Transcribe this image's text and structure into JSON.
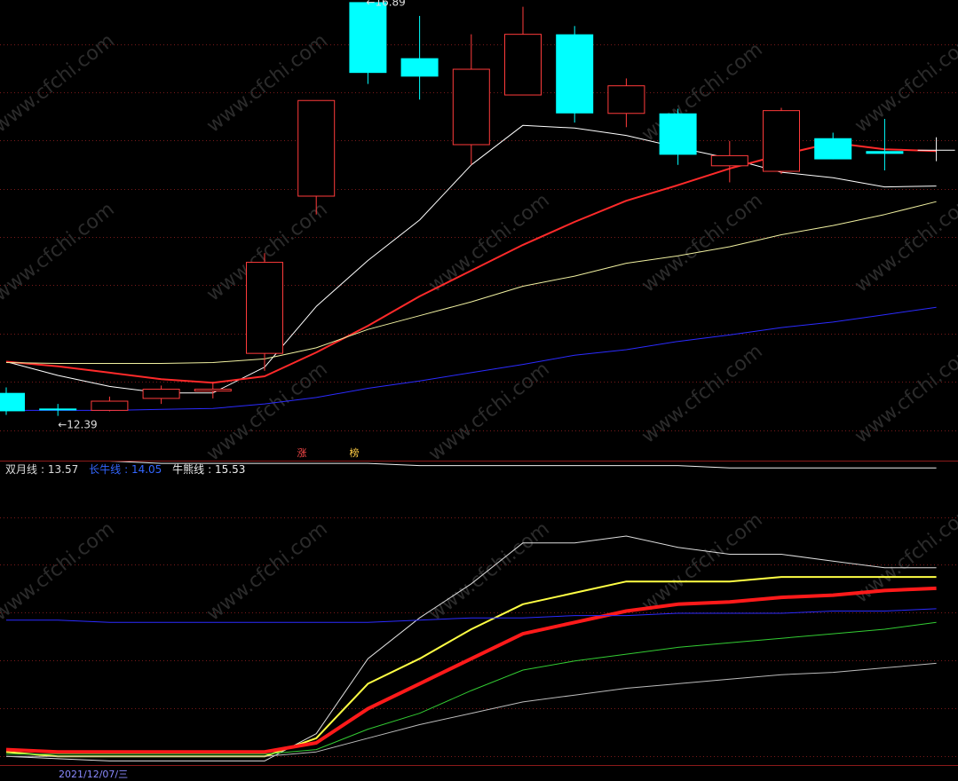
{
  "colors": {
    "background": "#000000",
    "grid": "#7a1a1a",
    "up_candle": "#ff3b3b",
    "down_candle": "#00ffff",
    "divider": "#8b1a1a",
    "watermark": "#2b2b2b"
  },
  "watermark_text": "www.cfchi.com",
  "price_panel": {
    "high_label": "16.89",
    "low_label": "12.39",
    "badges": [
      {
        "text": "涨",
        "color": "#ff4a4a"
      },
      {
        "text": "榜",
        "color": "#ffcc44"
      }
    ]
  },
  "legend": {
    "items": [
      {
        "name": "双月线",
        "value": "13.57",
        "color": "#dddddd"
      },
      {
        "name": "长牛线",
        "value": "14.05",
        "color": "#3366ff"
      },
      {
        "name": "牛熊线",
        "value": "15.53",
        "color": "#eeeeee"
      }
    ]
  },
  "date_label": "2021/12/07/三",
  "chart_data": [
    {
      "type": "candlestick",
      "title": "",
      "ylim": [
        12.0,
        17.0
      ],
      "candles": [
        {
          "open": 12.64,
          "close": 12.44,
          "high": 12.7,
          "low": 12.4,
          "dir": "down"
        },
        {
          "open": 12.47,
          "close": 12.45,
          "high": 12.52,
          "low": 12.39,
          "dir": "down"
        },
        {
          "open": 12.45,
          "close": 12.55,
          "high": 12.6,
          "low": 12.44,
          "dir": "up"
        },
        {
          "open": 12.58,
          "close": 12.68,
          "high": 12.72,
          "low": 12.52,
          "dir": "up"
        },
        {
          "open": 12.66,
          "close": 12.68,
          "high": 12.76,
          "low": 12.58,
          "dir": "up"
        },
        {
          "open": 13.07,
          "close": 14.06,
          "high": 14.16,
          "low": 12.88,
          "dir": "up"
        },
        {
          "open": 14.78,
          "close": 15.82,
          "high": 15.82,
          "low": 14.58,
          "dir": "up"
        },
        {
          "open": 16.12,
          "close": 16.89,
          "high": 16.89,
          "low": 16.0,
          "dir": "down"
        },
        {
          "open": 16.08,
          "close": 16.28,
          "high": 16.74,
          "low": 15.83,
          "dir": "down"
        },
        {
          "open": 15.34,
          "close": 16.16,
          "high": 16.54,
          "low": 15.12,
          "dir": "up"
        },
        {
          "open": 15.88,
          "close": 16.54,
          "high": 16.84,
          "low": 15.88,
          "dir": "up"
        },
        {
          "open": 15.68,
          "close": 16.54,
          "high": 16.63,
          "low": 15.58,
          "dir": "down"
        },
        {
          "open": 15.68,
          "close": 15.98,
          "high": 16.06,
          "low": 15.53,
          "dir": "up"
        },
        {
          "open": 15.23,
          "close": 15.68,
          "high": 15.73,
          "low": 15.12,
          "dir": "down"
        },
        {
          "open": 15.11,
          "close": 15.22,
          "high": 15.38,
          "low": 14.93,
          "dir": "up"
        },
        {
          "open": 15.05,
          "close": 15.71,
          "high": 15.74,
          "low": 15.02,
          "dir": "up"
        },
        {
          "open": 15.18,
          "close": 15.41,
          "high": 15.47,
          "low": 15.18,
          "dir": "down"
        },
        {
          "open": 15.24,
          "close": 15.27,
          "high": 15.62,
          "low": 15.06,
          "dir": "down"
        },
        {
          "open": 15.28,
          "close": 15.28,
          "high": 15.42,
          "low": 15.16,
          "dir": "neutral"
        }
      ],
      "series": [
        {
          "color": "#ffffff",
          "width": 1,
          "values": [
            12.98,
            12.83,
            12.71,
            12.64,
            12.64,
            12.92,
            13.58,
            14.08,
            14.52,
            15.12,
            15.55,
            15.52,
            15.44,
            15.31,
            15.19,
            15.04,
            14.98,
            14.88,
            14.89
          ]
        },
        {
          "color": "#ff2a2a",
          "width": 2,
          "values": [
            12.98,
            12.93,
            12.86,
            12.79,
            12.75,
            12.82,
            13.08,
            13.37,
            13.69,
            13.97,
            14.25,
            14.5,
            14.73,
            14.9,
            15.08,
            15.23,
            15.36,
            15.29,
            15.27
          ]
        },
        {
          "color": "#f0f0a0",
          "width": 1,
          "values": [
            12.97,
            12.96,
            12.96,
            12.96,
            12.97,
            13.01,
            13.13,
            13.33,
            13.48,
            13.63,
            13.8,
            13.91,
            14.05,
            14.13,
            14.23,
            14.36,
            14.46,
            14.58,
            14.72
          ]
        },
        {
          "color": "#2b2bff",
          "width": 1,
          "values": [
            12.45,
            12.45,
            12.45,
            12.46,
            12.47,
            12.52,
            12.59,
            12.69,
            12.77,
            12.86,
            12.95,
            13.05,
            13.11,
            13.2,
            13.27,
            13.35,
            13.41,
            13.49,
            13.57
          ]
        }
      ]
    },
    {
      "type": "line",
      "title": "",
      "ylim": [
        0,
        100
      ],
      "series": [
        {
          "name": "双月线",
          "color": "#dddddd",
          "width": 1,
          "values": [
            3,
            2,
            1,
            1,
            1,
            1,
            13,
            46,
            64,
            79,
            97,
            97,
            100,
            95,
            92,
            92,
            89,
            86,
            86
          ]
        },
        {
          "name": "",
          "color": "#ffff44",
          "width": 2,
          "values": [
            5,
            3,
            3,
            3,
            3,
            3,
            11,
            35,
            46,
            59,
            70,
            75,
            80,
            80,
            80,
            82,
            82,
            82,
            82
          ]
        },
        {
          "name": "",
          "color": "#ff1a1a",
          "width": 4,
          "values": [
            6,
            5,
            5,
            5,
            5,
            5,
            9,
            24,
            35,
            46,
            57,
            62,
            67,
            70,
            71,
            73,
            74,
            76,
            77
          ]
        },
        {
          "name": "",
          "color": "#33cc33",
          "width": 1,
          "values": [
            4,
            4,
            4,
            4,
            4,
            4,
            6,
            15,
            22,
            32,
            41,
            45,
            48,
            51,
            53,
            55,
            57,
            59,
            62
          ]
        },
        {
          "name": "",
          "color": "#bbbbbb",
          "width": 1,
          "values": [
            3,
            3,
            3,
            3,
            3,
            3,
            5,
            11,
            17,
            22,
            27,
            30,
            33,
            35,
            37,
            39,
            40,
            42,
            44
          ]
        },
        {
          "name": "长牛线",
          "color": "#2b2bff",
          "width": 1,
          "values": [
            63,
            63,
            62,
            62,
            62,
            62,
            62,
            62,
            63,
            64,
            64,
            65,
            65,
            66,
            66,
            66,
            67,
            67,
            68
          ]
        },
        {
          "name": "牛熊线",
          "color": "#eeeeee",
          "width": 1,
          "values": [
            133,
            133,
            133,
            132,
            132,
            132,
            132,
            132,
            131,
            131,
            131,
            131,
            131,
            131,
            130,
            130,
            130,
            130,
            130
          ]
        }
      ]
    }
  ]
}
